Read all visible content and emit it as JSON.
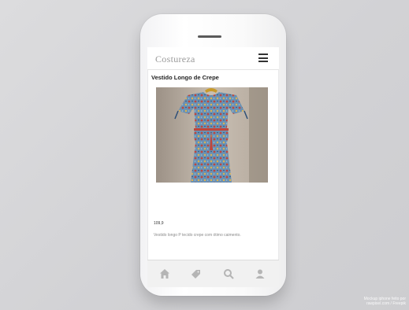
{
  "app": {
    "logo_text": "Costureza",
    "menu_icon": "hamburger-menu-icon"
  },
  "product": {
    "title": "Vestido Longo de Crepe",
    "price": "109,9",
    "description": "Vestido longo P tecido crepe com ótimo caimento."
  },
  "bottom_nav": {
    "items": [
      {
        "name": "home",
        "icon": "home-icon"
      },
      {
        "name": "tags",
        "icon": "tag-icon"
      },
      {
        "name": "search",
        "icon": "search-icon"
      },
      {
        "name": "profile",
        "icon": "user-icon"
      }
    ]
  },
  "credit": {
    "line1": "Mockup iphone feito por",
    "line2": "rawpixel.com / Freepik"
  },
  "colors": {
    "background": "#d7d7d9",
    "nav_icon": "#b5b5b5",
    "dress_base": "#6b91b3"
  }
}
